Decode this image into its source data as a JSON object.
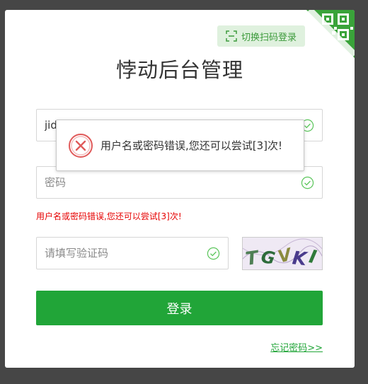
{
  "header": {
    "switch_label": "切换扫码登录",
    "title": "悖动后台管理"
  },
  "form": {
    "username_value": "jid",
    "password_placeholder": "密码",
    "captcha_placeholder": "请填写验证码",
    "error_message": "用户名或密码错误,您还可以尝试[3]次!",
    "captcha_text": "TGVKI",
    "login_label": "登录",
    "forgot_label": "忘记密码>>"
  },
  "toast": {
    "message": "用户名或密码错误,您还可以尝试[3]次!"
  },
  "colors": {
    "accent": "#21a538",
    "error": "#e60000",
    "backdrop": "#464646"
  },
  "icons": {
    "qr": "qr-code-icon",
    "scan": "scan-icon",
    "check": "check-circle-icon",
    "error": "error-circle-icon"
  }
}
